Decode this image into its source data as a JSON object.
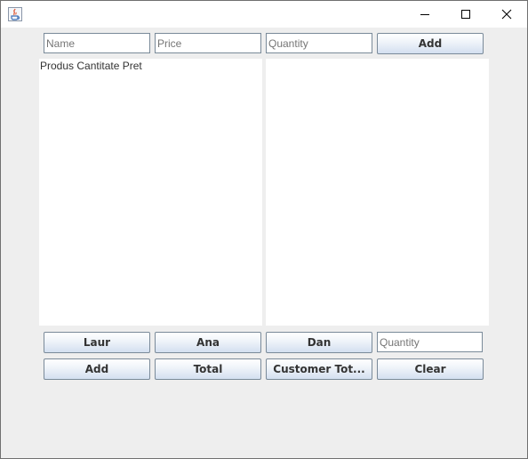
{
  "window": {
    "icon": "java-coffee-icon",
    "controls": [
      "minimize-icon",
      "maximize-icon",
      "close-icon"
    ]
  },
  "top_inputs": {
    "name_placeholder": "Name",
    "price_placeholder": "Price",
    "quantity_placeholder": "Quantity",
    "add_label": "Add"
  },
  "left_panel": {
    "text": "Produs Cantitate Pret"
  },
  "right_panel": {
    "text": ""
  },
  "customer_buttons": {
    "laur_label": "Laur",
    "ana_label": "Ana",
    "dan_label": "Dan",
    "quantity_placeholder": "Quantity"
  },
  "bottom_buttons": {
    "add_label": "Add",
    "total_label": "Total",
    "customer_total_label": "Customer Tot...",
    "clear_label": "Clear"
  },
  "colors": {
    "background": "#eeeeee",
    "panel": "#ffffff",
    "button_gradient_end": "#d3dff0",
    "border": "#7a8a99"
  }
}
